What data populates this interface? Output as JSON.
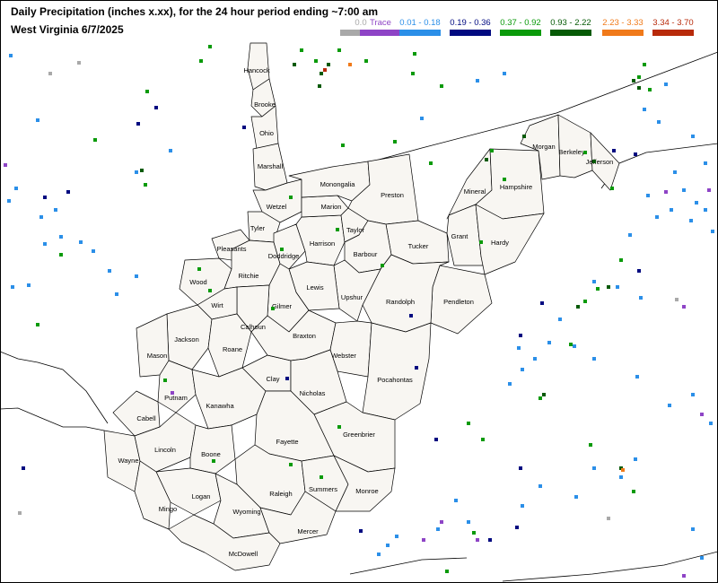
{
  "header": {
    "title": "Daily Precipitation (inches  x.xx),  for the 24 hour period ending ~7:00 am",
    "subtitle": "West Virginia 6/7/2025"
  },
  "legend": [
    {
      "label": "0.0",
      "color": "#a9a9a9"
    },
    {
      "label": "Trace",
      "color": "#8e44c6"
    },
    {
      "label": "0.01 - 0.18",
      "color": "#2b8fe8"
    },
    {
      "label": "0.19 - 0.36",
      "color": "#000a80"
    },
    {
      "label": "0.37 - 0.92",
      "color": "#0a9a0a"
    },
    {
      "label": "0.93 - 2.22",
      "color": "#065a06"
    },
    {
      "label": "2.23 - 3.33",
      "color": "#f07a1a"
    },
    {
      "label": "3.34 - 3.70",
      "color": "#b82a0a"
    }
  ],
  "counties": [
    "Hancock",
    "Brooke",
    "Ohio",
    "Marshall",
    "Wetzel",
    "Tyler",
    "Pleasants",
    "Wood",
    "Ritchie",
    "Doddridge",
    "Harrison",
    "Marion",
    "Monongalia",
    "Taylor",
    "Preston",
    "Tucker",
    "Barbour",
    "Mineral",
    "Hampshire",
    "Morgan",
    "Berkeley",
    "Jefferson",
    "Grant",
    "Hardy",
    "Pendleton",
    "Randolph",
    "Upshur",
    "Lewis",
    "Gilmer",
    "Calhoun",
    "Wirt",
    "Jackson",
    "Roane",
    "Mason",
    "Putnam",
    "Kanawha",
    "Clay",
    "Braxton",
    "Webster",
    "Pocahontas",
    "Nicholas",
    "Greenbrier",
    "Fayette",
    "Cabell",
    "Wayne",
    "Lincoln",
    "Boone",
    "Logan",
    "Mingo",
    "Raleigh",
    "Summers",
    "Monroe",
    "Wyoming",
    "Mercer",
    "McDowell"
  ]
}
